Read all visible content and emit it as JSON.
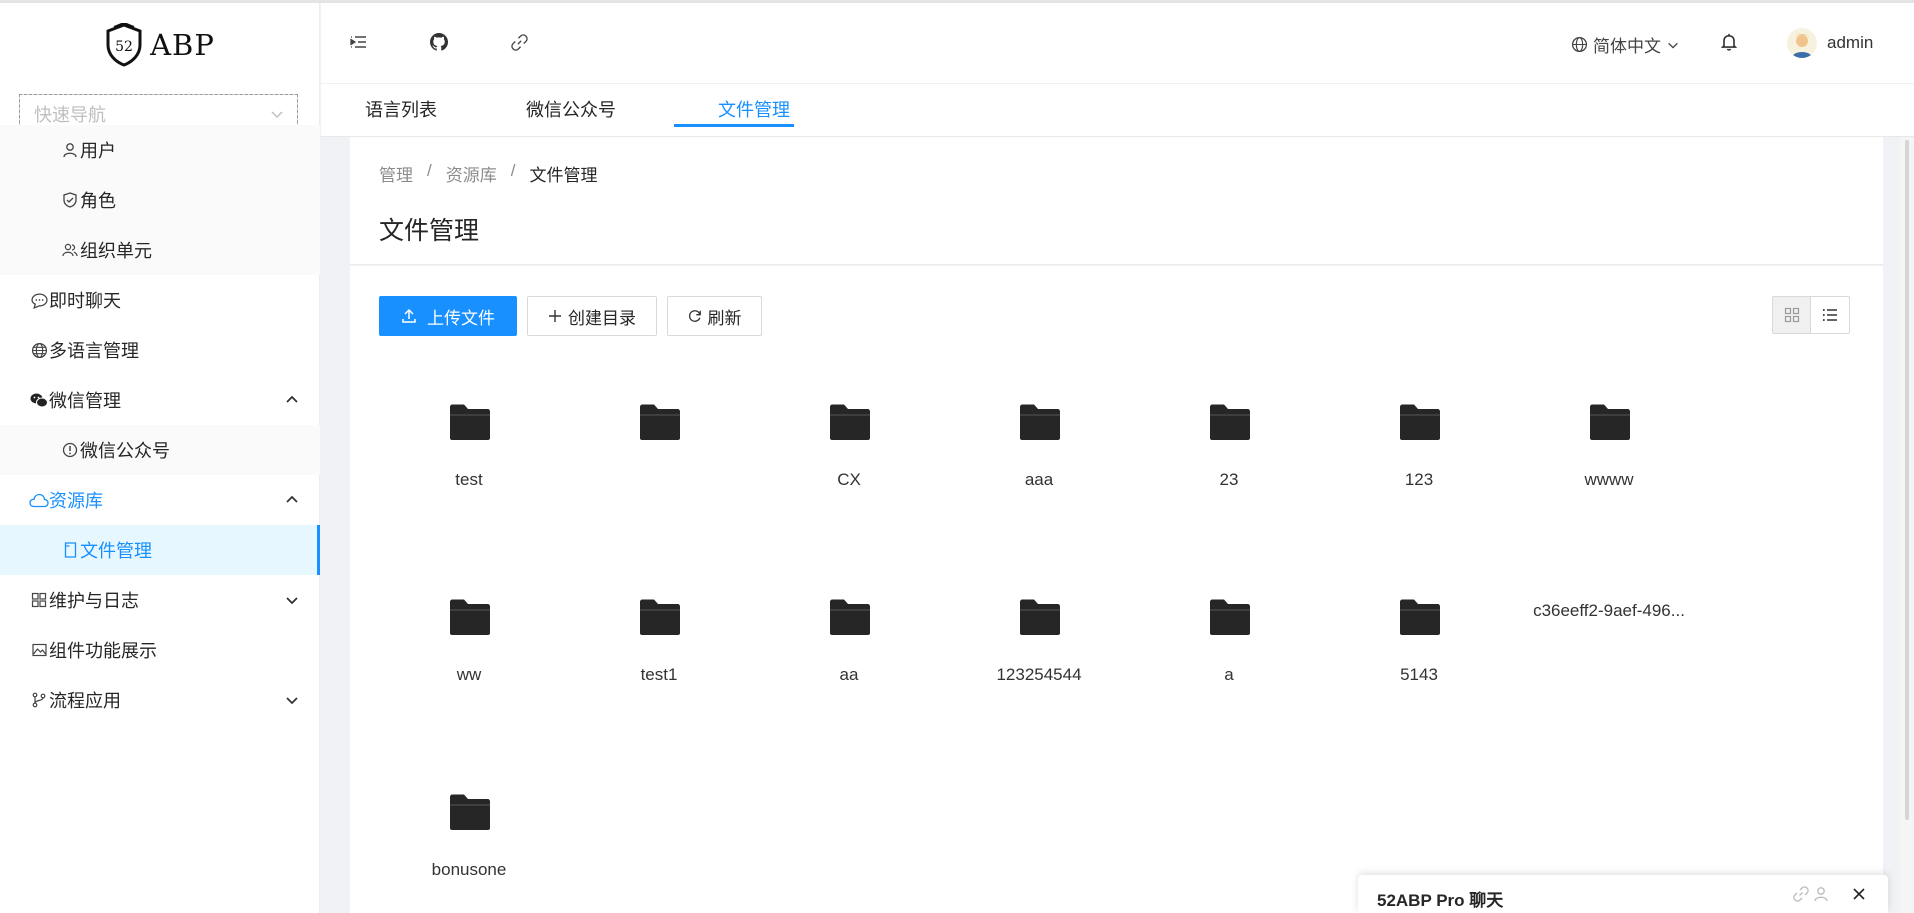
{
  "brand": {
    "logo_number": "52",
    "logo_text": "ABP"
  },
  "quick_nav": {
    "placeholder": "快速导航"
  },
  "sidebar": {
    "items": [
      {
        "label": "用户",
        "icon": "user-icon",
        "level": 2
      },
      {
        "label": "角色",
        "icon": "shield-check-icon",
        "level": 2
      },
      {
        "label": "组织单元",
        "icon": "team-icon",
        "level": 2
      },
      {
        "label": "即时聊天",
        "icon": "chat-bubble-icon",
        "level": 1
      },
      {
        "label": "多语言管理",
        "icon": "globe-icon",
        "level": 1
      },
      {
        "label": "微信管理",
        "icon": "wechat-icon",
        "level": 1,
        "expanded": true
      },
      {
        "label": "微信公众号",
        "icon": "info-circle-icon",
        "level": 2
      },
      {
        "label": "资源库",
        "icon": "cloud-icon",
        "level": 1,
        "expanded": true
      },
      {
        "label": "文件管理",
        "icon": "file-icon",
        "level": 2,
        "selected": true
      },
      {
        "label": "维护与日志",
        "icon": "grid-icon",
        "level": 1,
        "expanded": false
      },
      {
        "label": "组件功能展示",
        "icon": "picture-icon",
        "level": 1
      },
      {
        "label": "流程应用",
        "icon": "branch-icon",
        "level": 1,
        "expanded": false
      }
    ]
  },
  "header": {
    "language": "简体中文",
    "username": "admin",
    "icons": [
      "menu-fold-icon",
      "github-icon",
      "link-icon",
      "globe-icon",
      "bell-icon"
    ]
  },
  "tabs": [
    {
      "label": "语言列表",
      "active": false
    },
    {
      "label": "微信公众号",
      "active": false
    },
    {
      "label": "文件管理",
      "active": true
    }
  ],
  "breadcrumb": [
    "管理",
    "资源库",
    "文件管理"
  ],
  "breadcrumb_sep": "/",
  "page_title": "文件管理",
  "toolbar": {
    "upload": "上传文件",
    "create_dir": "创建目录",
    "refresh": "刷新"
  },
  "files": [
    {
      "name": "test",
      "type": "folder"
    },
    {
      "name": "",
      "type": "folder"
    },
    {
      "name": "CX",
      "type": "folder"
    },
    {
      "name": "aaa",
      "type": "folder"
    },
    {
      "name": "23",
      "type": "folder"
    },
    {
      "name": "123",
      "type": "folder"
    },
    {
      "name": "wwww",
      "type": "folder"
    },
    {
      "name": "ww",
      "type": "folder"
    },
    {
      "name": "test1",
      "type": "folder"
    },
    {
      "name": "aa",
      "type": "folder"
    },
    {
      "name": "123254544",
      "type": "folder"
    },
    {
      "name": "a",
      "type": "folder"
    },
    {
      "name": "5143",
      "type": "folder"
    },
    {
      "name": "c36eeff2-9aef-496...",
      "type": "file"
    },
    {
      "name": "bonusone",
      "type": "folder"
    }
  ],
  "chat": {
    "title": "52ABP Pro 聊天"
  },
  "colors": {
    "accent": "#1890ff",
    "selected_bg": "#e6f7ff",
    "folder": "#262626"
  }
}
